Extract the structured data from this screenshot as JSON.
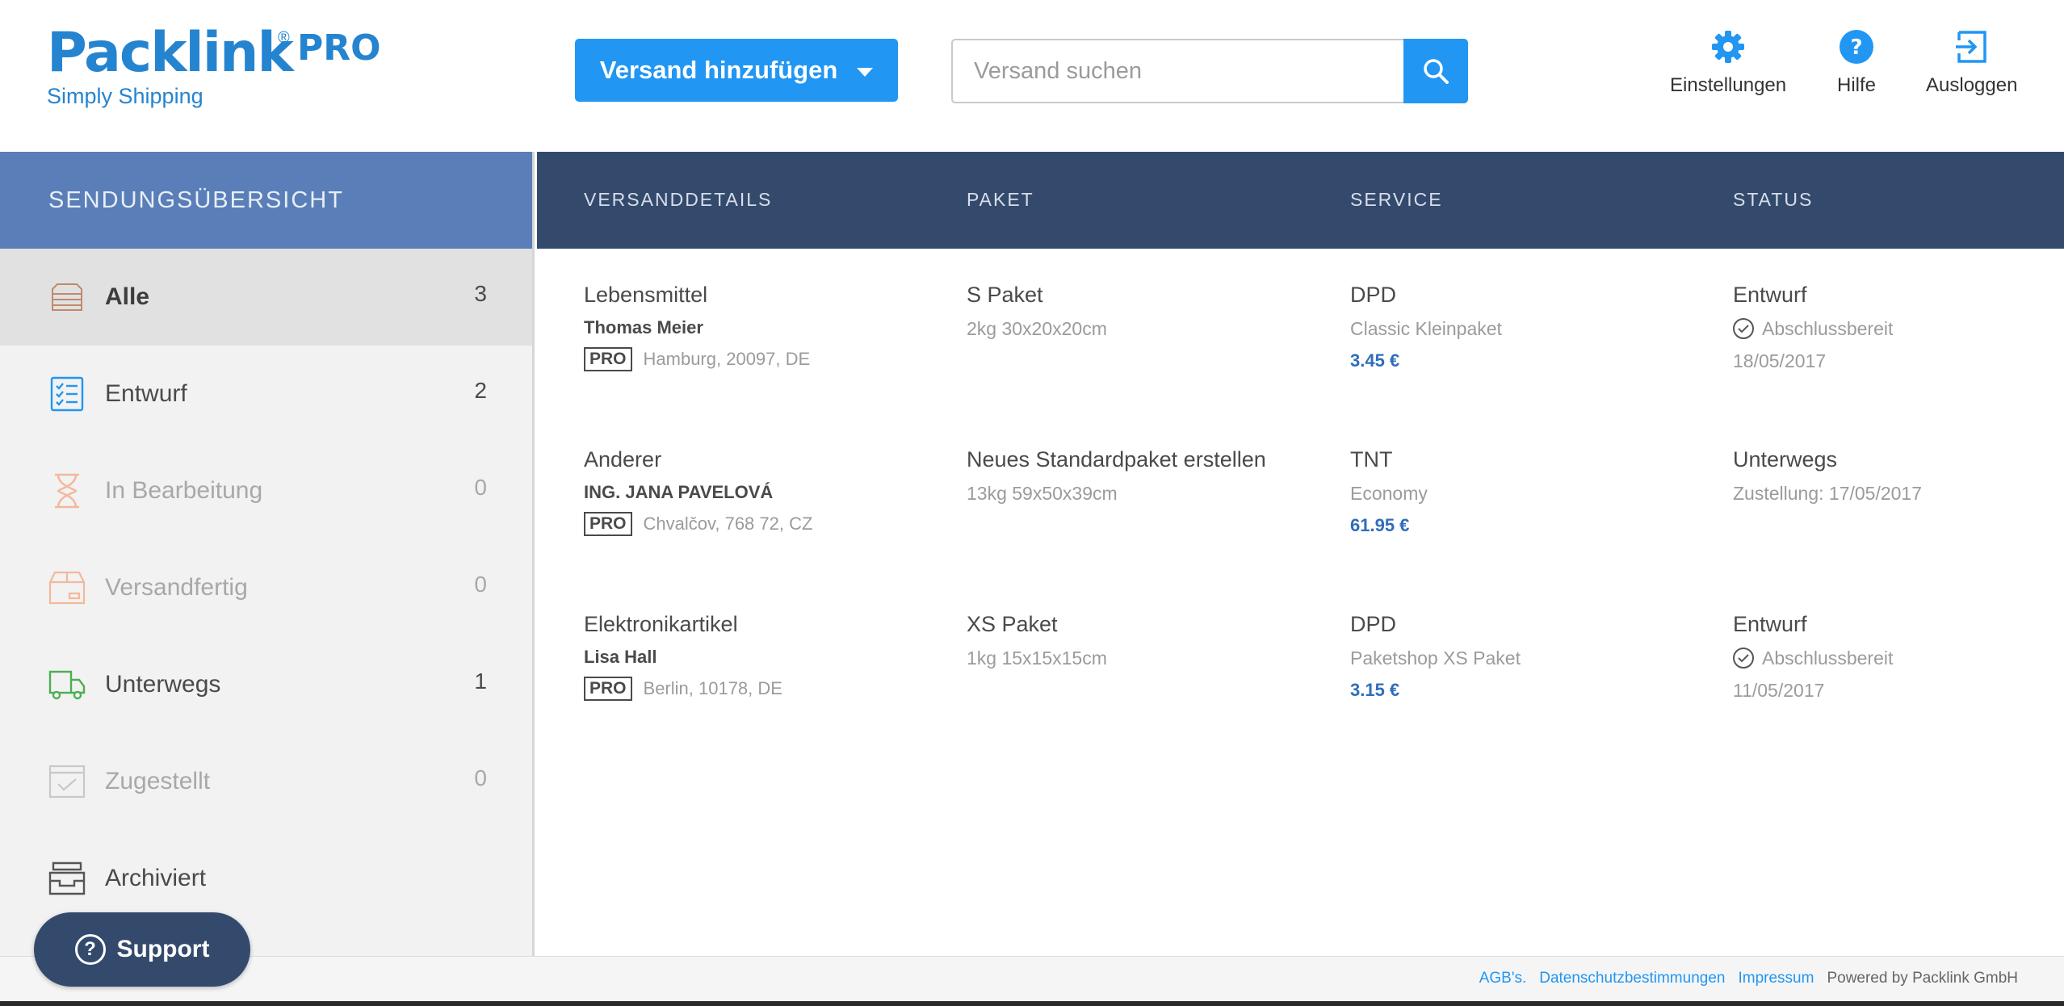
{
  "logo": {
    "name": "Packlink",
    "reg": "®",
    "pro": "PRO",
    "tagline": "Simply Shipping"
  },
  "header": {
    "add_button": "Versand hinzufügen",
    "search_placeholder": "Versand suchen",
    "actions": {
      "settings": "Einstellungen",
      "help": "Hilfe",
      "logout": "Ausloggen"
    }
  },
  "sidebar": {
    "title": "SENDUNGSÜBERSICHT",
    "items": [
      {
        "label": "Alle",
        "count": "3",
        "icon": "stack-icon"
      },
      {
        "label": "Entwurf",
        "count": "2",
        "icon": "checklist-icon"
      },
      {
        "label": "In Bearbeitung",
        "count": "0",
        "icon": "hourglass-icon"
      },
      {
        "label": "Versandfertig",
        "count": "0",
        "icon": "box-icon"
      },
      {
        "label": "Unterwegs",
        "count": "1",
        "icon": "truck-icon"
      },
      {
        "label": "Zugestellt",
        "count": "0",
        "icon": "delivered-icon"
      },
      {
        "label": "Archiviert",
        "count": "",
        "icon": "archive-icon"
      }
    ]
  },
  "table": {
    "headers": {
      "details": "VERSANDDETAILS",
      "package": "PAKET",
      "service": "SERVICE",
      "status": "STATUS"
    },
    "rows": [
      {
        "title": "Lebensmittel",
        "recipient": "Thomas Meier",
        "badge": "PRO",
        "address": "Hamburg, 20097, DE",
        "package": "S Paket",
        "package_desc": "2kg 30x20x20cm",
        "carrier": "DPD",
        "service": "Classic Kleinpaket",
        "price": "3.45 €",
        "status": "Entwurf",
        "status_sub": "Abschlussbereit",
        "date": "18/05/2017"
      },
      {
        "title": "Anderer",
        "recipient": "ING. JANA PAVELOVÁ",
        "badge": "PRO",
        "address": "Chvalčov, 768 72, CZ",
        "package": "Neues Standardpaket erstellen",
        "package_desc": "13kg 59x50x39cm",
        "carrier": "TNT",
        "service": "Economy",
        "price": "61.95 €",
        "status": "Unterwegs",
        "status_sub": "Zustellung: 17/05/2017",
        "date": ""
      },
      {
        "title": "Elektronikartikel",
        "recipient": "Lisa Hall",
        "badge": "PRO",
        "address": "Berlin, 10178, DE",
        "package": "XS Paket",
        "package_desc": "1kg 15x15x15cm",
        "carrier": "DPD",
        "service": "Paketshop XS Paket",
        "price": "3.15 €",
        "status": "Entwurf",
        "status_sub": "Abschlussbereit",
        "date": "11/05/2017"
      }
    ]
  },
  "footer": {
    "links": [
      "AGB's.",
      "Datenschutzbestimmungen",
      "Impressum"
    ],
    "powered": "Powered by Packlink GmbH"
  },
  "support": {
    "label": "Support"
  },
  "colors": {
    "brand": "#2584d0",
    "primary": "#2196f3",
    "sidebar_head": "#5a7fb8",
    "table_head": "#344a6d",
    "price": "#2f6dbb"
  }
}
